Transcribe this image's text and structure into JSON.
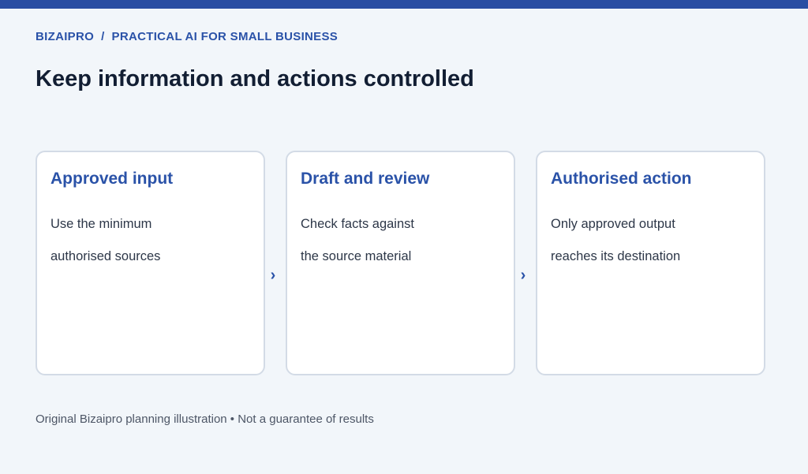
{
  "header": {
    "brand": "BIZAIPRO",
    "separator": "/",
    "section": "PRACTICAL AI FOR SMALL BUSINESS",
    "title": "Keep information and actions controlled"
  },
  "steps": [
    {
      "title": "Approved input",
      "lines": [
        "Use the minimum",
        "authorised sources"
      ]
    },
    {
      "title": "Draft and review",
      "lines": [
        "Check facts against",
        "the source material"
      ]
    },
    {
      "title": "Authorised action",
      "lines": [
        "Only approved output",
        "reaches its destination"
      ]
    }
  ],
  "connector_glyph": "›",
  "footer": {
    "note": "Original Bizaipro planning illustration • Not a guarantee of results"
  },
  "colors": {
    "accent": "#2a52a8",
    "top_bar": "#2a4ea3",
    "background": "#f2f6fa",
    "card_border": "#d3dbe6",
    "title_text": "#121e33",
    "body_text": "#2d3748"
  }
}
